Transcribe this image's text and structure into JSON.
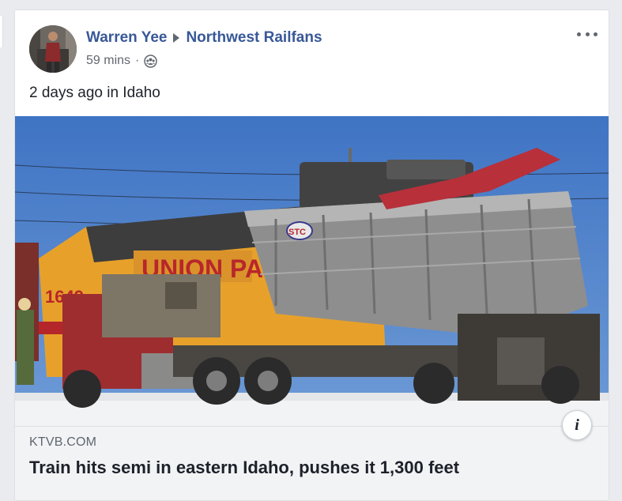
{
  "post": {
    "author": "Warren Yee",
    "group": "Northwest Railfans",
    "time": "59 mins",
    "separator": "·",
    "privacy_icon": "group-icon",
    "text": "2 days ago in Idaho",
    "photo_alt": "Union Pacific locomotive collided with semi truck trailer",
    "photo_locomotive_number": "1649",
    "photo_locomotive_lettering": "UNION PAC",
    "photo_trailer_emblem": "STC"
  },
  "link": {
    "domain": "KTVB.COM",
    "title": "Train hits semi in eastern Idaho, pushes it 1,300 feet"
  },
  "colors": {
    "link_blue": "#385898",
    "meta_gray": "#616770",
    "text_dark": "#1d2129",
    "feed_bg": "#e9ebee",
    "link_bg": "#f2f3f5"
  }
}
